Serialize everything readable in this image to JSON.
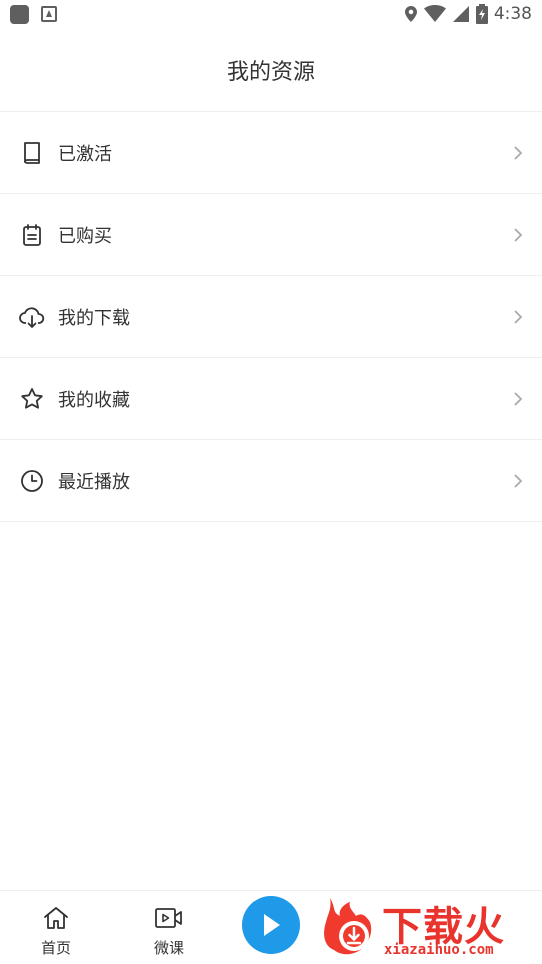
{
  "status_bar": {
    "time": "4:38"
  },
  "header": {
    "title": "我的资源"
  },
  "menu": {
    "items": [
      {
        "label": "已激活",
        "icon": "book-icon"
      },
      {
        "label": "已购买",
        "icon": "clipboard-icon"
      },
      {
        "label": "我的下载",
        "icon": "cloud-download-icon"
      },
      {
        "label": "我的收藏",
        "icon": "star-icon"
      },
      {
        "label": "最近播放",
        "icon": "clock-icon"
      }
    ]
  },
  "bottom_nav": {
    "home_label": "首页",
    "lesson_label": "微课"
  },
  "watermark": {
    "brand": "下载火",
    "url": "xiazaihuo.com"
  },
  "colors": {
    "accent": "#1e9ae8",
    "watermark": "#e8342c",
    "divider": "#eeeeee"
  }
}
